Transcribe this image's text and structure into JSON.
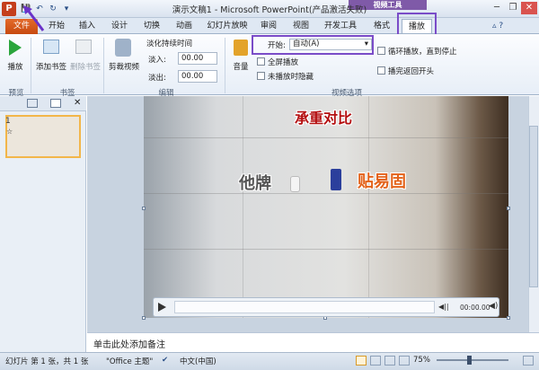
{
  "window": {
    "title": "演示文稿1 - Microsoft PowerPoint(产品激活失败)",
    "context_tab_group": "视频工具",
    "app_icon_letter": "P"
  },
  "qat": {
    "save": "💾",
    "undo": "↶",
    "redo": "↻",
    "customize": "▾"
  },
  "win_controls": {
    "minimize": "─",
    "restore": "❐",
    "close": "✕"
  },
  "tabs": [
    {
      "label": "文件"
    },
    {
      "label": "开始"
    },
    {
      "label": "插入"
    },
    {
      "label": "设计"
    },
    {
      "label": "切换"
    },
    {
      "label": "动画"
    },
    {
      "label": "幻灯片放映"
    },
    {
      "label": "审阅"
    },
    {
      "label": "视图"
    },
    {
      "label": "开发工具"
    },
    {
      "label": "格式"
    },
    {
      "label": "播放"
    }
  ],
  "ribbon": {
    "preview_group": {
      "label": "预览",
      "play_label": "播放"
    },
    "bookmarks_group": {
      "label": "书签",
      "add_label": "添加书签",
      "remove_label": "删除书签"
    },
    "editing_group": {
      "label": "编辑",
      "trim_label": "剪裁视频",
      "fade_title": "淡化持续时间",
      "fade_in_label": "淡入:",
      "fade_in_value": "00.00",
      "fade_out_label": "淡出:",
      "fade_out_value": "00.00"
    },
    "video_options_group": {
      "label": "视频选项",
      "volume_label": "音量",
      "start_label": "开始:",
      "start_value": "自动(A)",
      "fullscreen_label": "全屏播放",
      "hide_label": "未播放时隐藏",
      "loop_label": "循环播放，直到停止",
      "rewind_label": "播完返回开头"
    }
  },
  "slide_pane": {
    "slide_number": "1",
    "star": "☆",
    "close": "✕"
  },
  "video": {
    "title_text": "承重对比",
    "left_text": "他牌",
    "right_text": "贴易固",
    "time": "00:00.00",
    "play_icon": "play-icon"
  },
  "notes": {
    "placeholder": "单击此处添加备注"
  },
  "status": {
    "slide_info": "幻灯片 第 1 张，共 1 张",
    "theme": "\"Office 主题\"",
    "language": "中文(中国)",
    "zoom": "75%"
  },
  "colors": {
    "file_tab": "#d85a1c",
    "video_tools": "#7f5aa8",
    "highlight": "#7a4cc8",
    "video_title_red": "#b40f10",
    "video_orange": "#e3621a"
  }
}
